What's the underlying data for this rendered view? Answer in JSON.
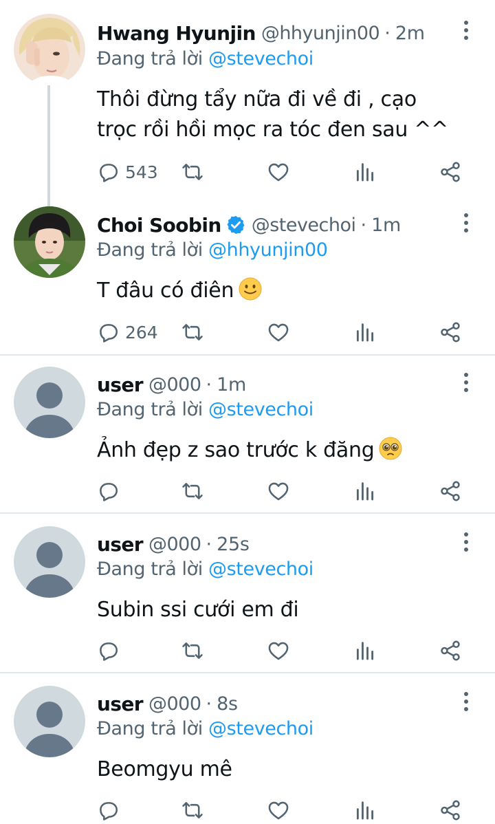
{
  "reply_prefix": "Đang trả lời",
  "tweets": [
    {
      "name": "Hwang Hyunjin",
      "handle": "@hhyunjin00",
      "time": "2m",
      "reply_to": "@stevechoi",
      "text": "Thôi đừng tẩy nữa đi về đi , cạo trọc rồi hồi mọc ra tóc đen sau ^^",
      "reply_count": "543",
      "verified": false
    },
    {
      "name": "Choi Soobin",
      "handle": "@stevechoi",
      "time": "1m",
      "reply_to": "@hhyunjin00",
      "text": "T đâu có điên",
      "reply_count": "264",
      "verified": true,
      "emoji": "slightly-smiling-face"
    },
    {
      "name": "user",
      "handle": "@000",
      "time": "1m",
      "reply_to": "@stevechoi",
      "text": "Ảnh đẹp z sao trước k đăng",
      "reply_count": "",
      "verified": false,
      "emoji": "pleading-face"
    },
    {
      "name": "user",
      "handle": "@000",
      "time": "25s",
      "reply_to": "@stevechoi",
      "text": "Subin ssi cưới em đi",
      "reply_count": "",
      "verified": false
    },
    {
      "name": "user",
      "handle": "@000",
      "time": "8s",
      "reply_to": "@stevechoi",
      "text": "Beomgyu mê",
      "reply_count": "",
      "verified": false
    }
  ],
  "colors": {
    "accent": "#1d9bf0",
    "secondary_text": "#536471",
    "divider": "#e1e8ed",
    "default_avatar_bg": "#cfd9de",
    "default_avatar_fg": "#66788a"
  },
  "icons": [
    "reply-icon",
    "retweet-icon",
    "like-icon",
    "views-icon",
    "share-icon",
    "more-icon",
    "verified-badge-icon"
  ]
}
